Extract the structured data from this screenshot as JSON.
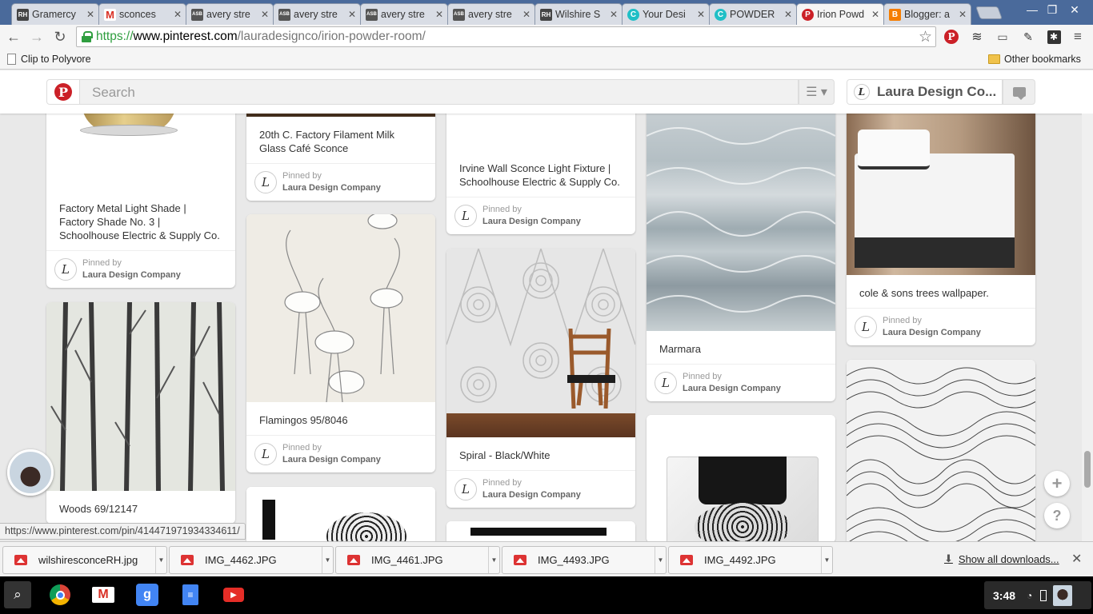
{
  "browser": {
    "tabs": [
      {
        "title": "Gramercy",
        "favicon": "RH",
        "color": "#444444"
      },
      {
        "title": "sconces",
        "favicon": "M",
        "color": "#d93025"
      },
      {
        "title": "avery stre",
        "favicon": "ASB",
        "color": "#555555"
      },
      {
        "title": "avery stre",
        "favicon": "ASB",
        "color": "#555555"
      },
      {
        "title": "avery stre",
        "favicon": "ASB",
        "color": "#555555"
      },
      {
        "title": "avery stre",
        "favicon": "ASB",
        "color": "#555555"
      },
      {
        "title": "Wilshire S",
        "favicon": "RH",
        "color": "#444444"
      },
      {
        "title": "Your Desi",
        "favicon": "C",
        "color": "#1fbfc6"
      },
      {
        "title": "POWDER",
        "favicon": "C",
        "color": "#1fbfc6"
      },
      {
        "title": "Irion Powd",
        "favicon": "P",
        "color": "#cb2027"
      },
      {
        "title": "Blogger: a",
        "favicon": "B",
        "color": "#f57d00"
      }
    ],
    "active_tab_index": 9,
    "url": {
      "scheme": "https://",
      "host": "www.pinterest.com",
      "path": "/lauradesignco/irion-powder-room/"
    },
    "bookmarks": [
      {
        "label": "Clip to Polyvore"
      }
    ],
    "other_bookmarks": "Other bookmarks",
    "status_url": "https://www.pinterest.com/pin/414471971934334611/"
  },
  "pinterest": {
    "search_placeholder": "Search",
    "profile_name": "Laura Design Co...",
    "avatar_letter": "L",
    "accent_color": "#cb2027"
  },
  "pins": [
    {
      "id": "p1",
      "description": "Factory Metal Light Shade | Factory Shade No. 3 | Schoolhouse Electric & Supply Co.",
      "pinned_label": "Pinned by",
      "pinner": "Laura Design Company"
    },
    {
      "id": "p2",
      "description": "Woods 69/12147",
      "pinned_label": "",
      "pinner": ""
    },
    {
      "id": "p3",
      "description": "20th C. Factory Filament Milk Glass Café Sconce",
      "pinned_label": "Pinned by",
      "pinner": "Laura Design Company"
    },
    {
      "id": "p4",
      "description": "Flamingos 95/8046",
      "pinned_label": "Pinned by",
      "pinner": "Laura Design Company"
    },
    {
      "id": "p5",
      "description": "",
      "pinned_label": "",
      "pinner": ""
    },
    {
      "id": "p6",
      "description": "Irvine Wall Sconce Light Fixture | Schoolhouse Electric & Supply Co.",
      "pinned_label": "Pinned by",
      "pinner": "Laura Design Company"
    },
    {
      "id": "p7",
      "description": "Spiral - Black/White",
      "pinned_label": "Pinned by",
      "pinner": "Laura Design Company"
    },
    {
      "id": "p8",
      "description": "",
      "pinned_label": "",
      "pinner": ""
    },
    {
      "id": "p9",
      "description": "Marmara",
      "pinned_label": "Pinned by",
      "pinner": "Laura Design Company"
    },
    {
      "id": "p10",
      "description": "",
      "pinned_label": "",
      "pinner": ""
    },
    {
      "id": "p11",
      "description": "cole & sons trees wallpaper.",
      "pinned_label": "Pinned by",
      "pinner": "Laura Design Company"
    },
    {
      "id": "p12",
      "description": "",
      "pinned_label": "",
      "pinner": ""
    }
  ],
  "downloads": [
    {
      "name": "wilshiresconceRH.jpg"
    },
    {
      "name": "IMG_4462.JPG"
    },
    {
      "name": "IMG_4461.JPG"
    },
    {
      "name": "IMG_4493.JPG"
    },
    {
      "name": "IMG_4492.JPG"
    }
  ],
  "show_all_downloads": "Show all downloads...",
  "os": {
    "time": "3:48"
  }
}
